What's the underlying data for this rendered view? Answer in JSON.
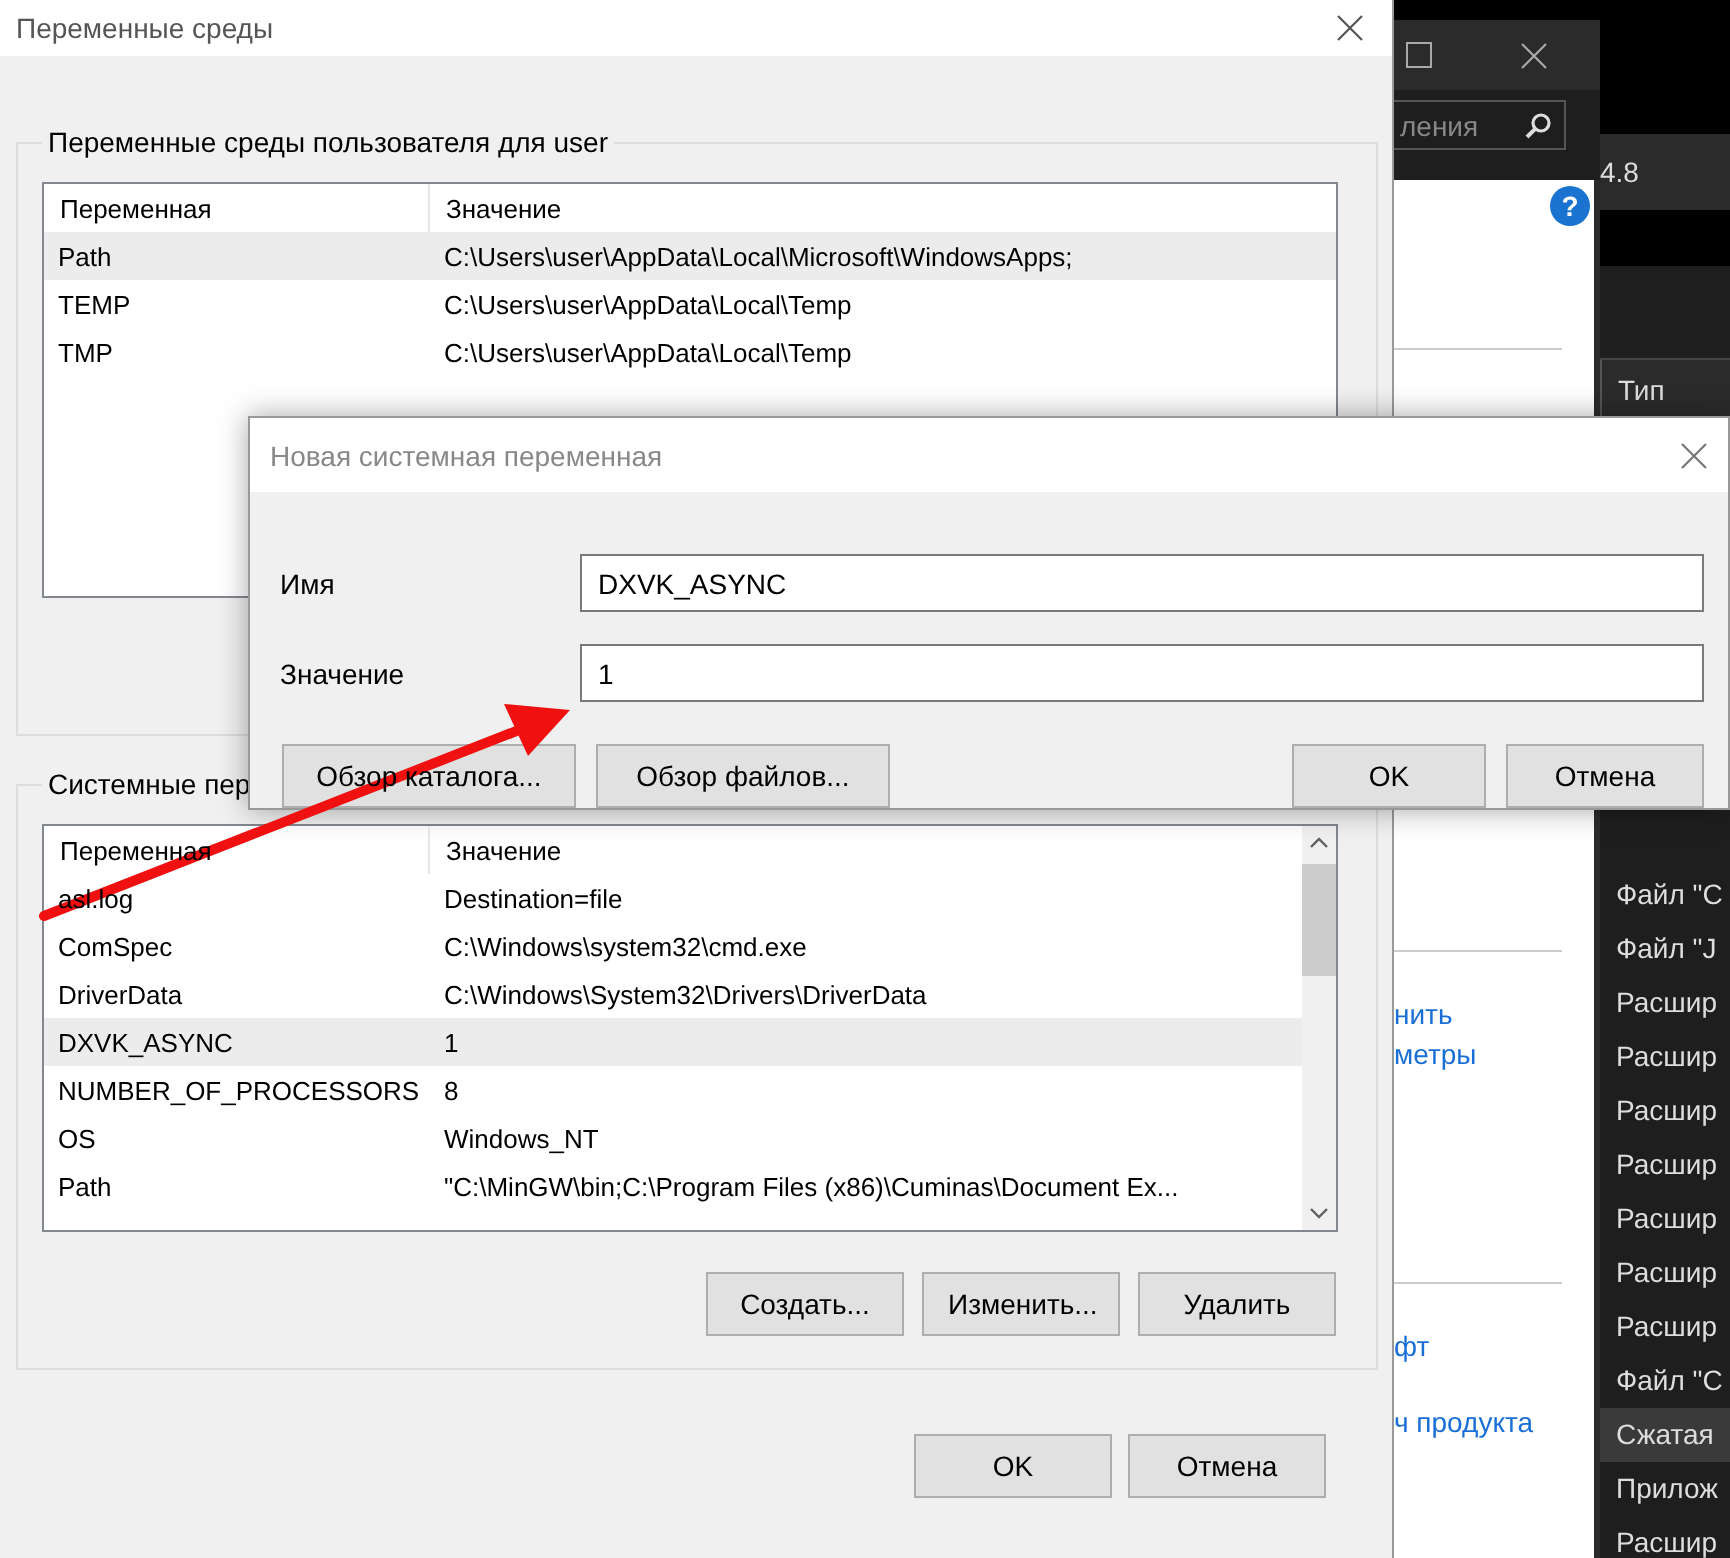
{
  "background_app": {
    "search": {
      "placeholder": "ления"
    },
    "help_glyph": "?",
    "version": "4.8",
    "column_header": "Тип",
    "links_top": [
      "нить",
      "метры"
    ],
    "links_bottom": [
      "фт",
      "ч продукта"
    ],
    "list_items": [
      {
        "label": "Файл \"С",
        "selected": false
      },
      {
        "label": "Файл \"J",
        "selected": false
      },
      {
        "label": "Расшир",
        "selected": false
      },
      {
        "label": "Расшир",
        "selected": false
      },
      {
        "label": "Расшир",
        "selected": false
      },
      {
        "label": "Расшир",
        "selected": false
      },
      {
        "label": "Расшир",
        "selected": false
      },
      {
        "label": "Расшир",
        "selected": false
      },
      {
        "label": "Расшир",
        "selected": false
      },
      {
        "label": "Файл \"С",
        "selected": false
      },
      {
        "label": "Сжатая",
        "selected": true
      },
      {
        "label": "Прилож",
        "selected": false
      },
      {
        "label": "Расшир",
        "selected": false
      }
    ]
  },
  "env_dialog": {
    "title": "Переменные среды",
    "user_group": {
      "title": "Переменные среды пользователя для user",
      "columns": [
        "Переменная",
        "Значение"
      ],
      "rows": [
        {
          "name": "Path",
          "value": "C:\\Users\\user\\AppData\\Local\\Microsoft\\WindowsApps;",
          "selected": true
        },
        {
          "name": "TEMP",
          "value": "C:\\Users\\user\\AppData\\Local\\Temp",
          "selected": false
        },
        {
          "name": "TMP",
          "value": "C:\\Users\\user\\AppData\\Local\\Temp",
          "selected": false
        }
      ]
    },
    "system_group": {
      "title": "Системные пер",
      "columns": [
        "Переменная",
        "Значение"
      ],
      "rows": [
        {
          "name": "asl.log",
          "value": "Destination=file",
          "selected": false
        },
        {
          "name": "ComSpec",
          "value": "C:\\Windows\\system32\\cmd.exe",
          "selected": false
        },
        {
          "name": "DriverData",
          "value": "C:\\Windows\\System32\\Drivers\\DriverData",
          "selected": false
        },
        {
          "name": "DXVK_ASYNC",
          "value": "1",
          "selected": true
        },
        {
          "name": "NUMBER_OF_PROCESSORS",
          "value": "8",
          "selected": false
        },
        {
          "name": "OS",
          "value": "Windows_NT",
          "selected": false
        },
        {
          "name": "Path",
          "value": "\"C:\\MinGW\\bin;C:\\Program Files (x86)\\Cuminas\\Document Ex...",
          "selected": false
        }
      ],
      "buttons": [
        "Создать...",
        "Изменить...",
        "Удалить"
      ]
    },
    "buttons": [
      "OK",
      "Отмена"
    ]
  },
  "new_var_dialog": {
    "title": "Новая системная переменная",
    "fields": [
      {
        "label": "Имя",
        "value": "DXVK_ASYNC"
      },
      {
        "label": "Значение",
        "value": "1"
      }
    ],
    "browse_buttons": [
      "Обзор каталога...",
      "Обзор файлов..."
    ],
    "buttons": [
      "OK",
      "Отмена"
    ]
  }
}
